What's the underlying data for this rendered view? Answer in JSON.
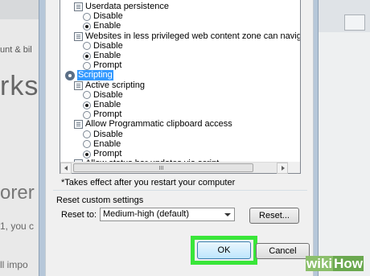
{
  "background": {
    "breadcrumb": "unt & bil",
    "heading": "rks",
    "subheading": "orer",
    "line1": "1, you c",
    "line2": "ll impo"
  },
  "settings_list": [
    {
      "kind": "setting",
      "label": "Userdata persistence",
      "indent": 1
    },
    {
      "kind": "radio",
      "label": "Disable",
      "checked": false,
      "indent": 2
    },
    {
      "kind": "radio",
      "label": "Enable",
      "checked": true,
      "indent": 2
    },
    {
      "kind": "setting",
      "label": "Websites in less privileged web content zone can navigate into th",
      "indent": 1
    },
    {
      "kind": "radio",
      "label": "Disable",
      "checked": false,
      "indent": 2
    },
    {
      "kind": "radio",
      "label": "Enable",
      "checked": true,
      "indent": 2
    },
    {
      "kind": "radio",
      "label": "Prompt",
      "checked": false,
      "indent": 2
    },
    {
      "kind": "category",
      "label": "Scripting",
      "selected": true,
      "indent": 0
    },
    {
      "kind": "setting",
      "label": "Active scripting",
      "indent": 1
    },
    {
      "kind": "radio",
      "label": "Disable",
      "checked": false,
      "indent": 2
    },
    {
      "kind": "radio",
      "label": "Enable",
      "checked": true,
      "indent": 2
    },
    {
      "kind": "radio",
      "label": "Prompt",
      "checked": false,
      "indent": 2
    },
    {
      "kind": "setting",
      "label": "Allow Programmatic clipboard access",
      "indent": 1
    },
    {
      "kind": "radio",
      "label": "Disable",
      "checked": false,
      "indent": 2
    },
    {
      "kind": "radio",
      "label": "Enable",
      "checked": false,
      "indent": 2
    },
    {
      "kind": "radio",
      "label": "Prompt",
      "checked": true,
      "indent": 2
    },
    {
      "kind": "setting",
      "label": "Allow status bar updates via script",
      "indent": 1
    }
  ],
  "note": "*Takes effect after you restart your computer",
  "reset": {
    "title": "Reset custom settings",
    "reset_to_label": "Reset to:",
    "selected_level": "Medium-high (default)",
    "reset_button": "Reset..."
  },
  "buttons": {
    "ok": "OK",
    "cancel": "Cancel"
  },
  "watermark": {
    "wiki": "wiki",
    "how": "How"
  },
  "colors": {
    "selection": "#3399ff",
    "highlight_box": "#39e639"
  }
}
